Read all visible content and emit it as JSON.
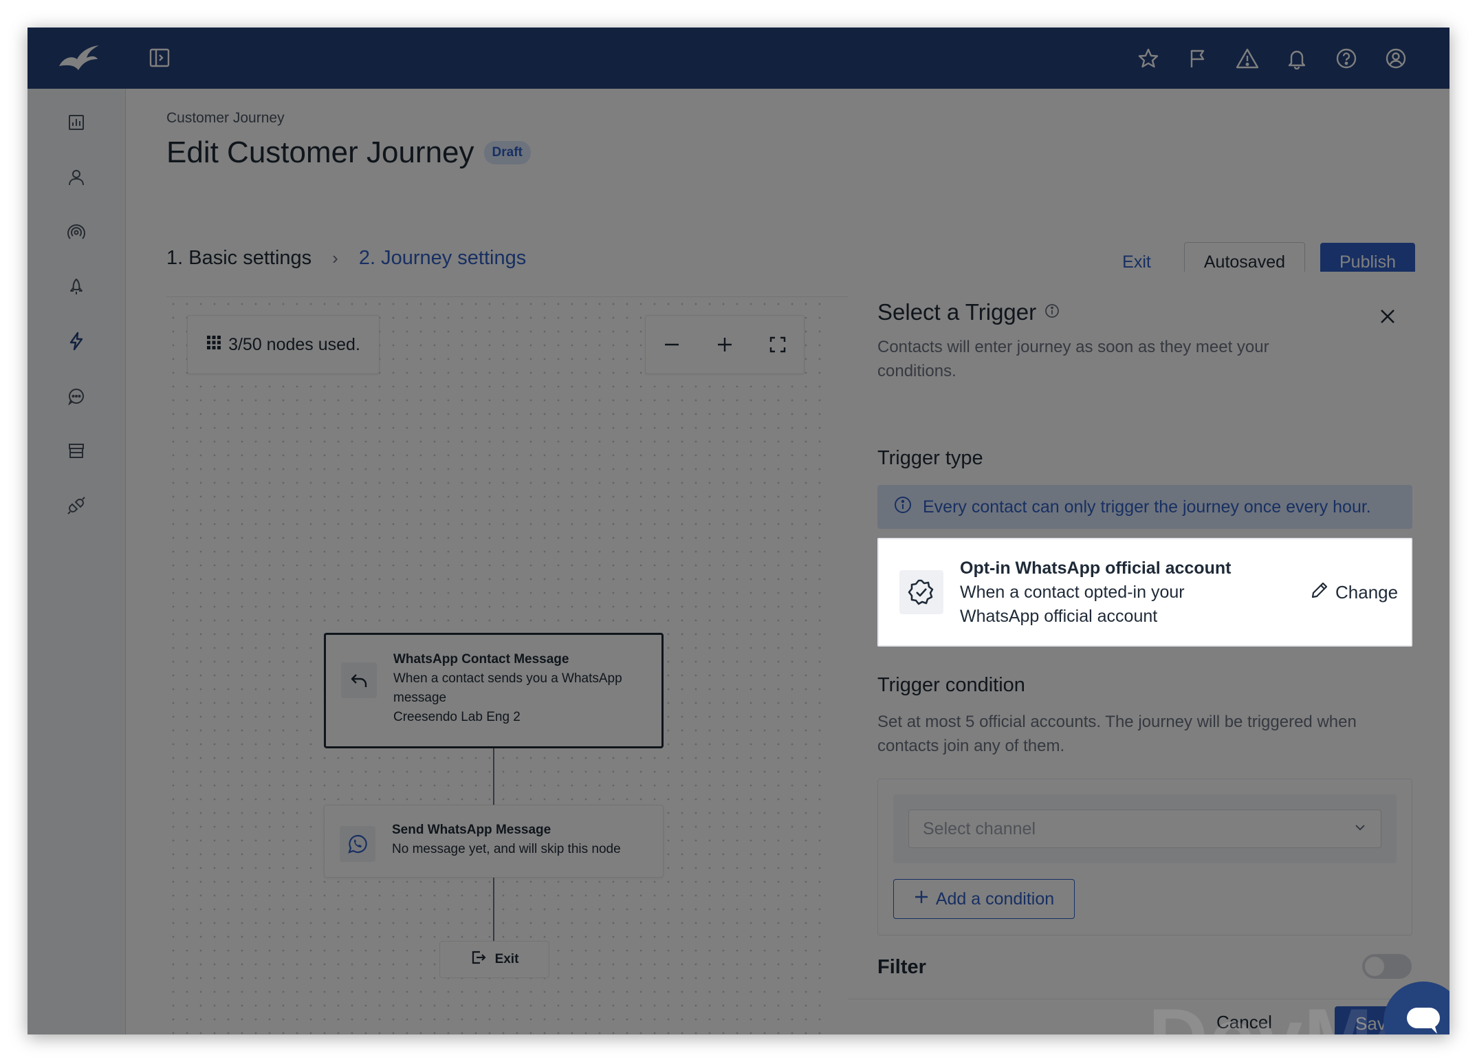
{
  "header": {
    "icons": [
      "logo-icon",
      "panel-toggle-icon",
      "star-icon",
      "flag-icon",
      "warning-icon",
      "bell-icon",
      "help-icon",
      "user-icon"
    ]
  },
  "sidebar": {
    "icons": [
      "chart-icon",
      "contacts-icon",
      "broadcast-icon",
      "rocket-icon",
      "lightning-icon",
      "chat-icon",
      "store-icon",
      "integration-icon"
    ]
  },
  "page": {
    "breadcrumb": "Customer Journey",
    "title": "Edit Customer Journey",
    "status_badge": "Draft"
  },
  "steps": {
    "step1": "1. Basic settings",
    "separator": "›",
    "step2": "2. Journey settings"
  },
  "actions": {
    "exit": "Exit",
    "autosaved": "Autosaved",
    "publish": "Publish"
  },
  "canvas": {
    "nodes_used": "3/50 nodes used.",
    "node1": {
      "title": "WhatsApp Contact Message",
      "line1": "When a contact sends you a WhatsApp",
      "line2": "message",
      "line3": "Creesendo Lab Eng 2"
    },
    "node2": {
      "title": "Send WhatsApp Message",
      "line1": "No message yet, and will skip this node"
    },
    "exit_node": "Exit"
  },
  "panel": {
    "title": "Select a Trigger",
    "subtitle": "Contacts will enter journey as soon as they meet your conditions.",
    "trigger_type_heading": "Trigger type",
    "info_banner": "Every contact can only trigger the journey once every hour.",
    "trigger_card": {
      "title": "Opt-in WhatsApp official account",
      "desc_line1": "When a contact opted-in your",
      "desc_line2": "WhatsApp official account",
      "change": "Change"
    },
    "trigger_condition_heading": "Trigger condition",
    "condition_text": "Set at most 5 official accounts. The journey will be triggered when contacts join any of them.",
    "select_placeholder": "Select channel",
    "add_condition": "Add a condition",
    "filter_label": "Filter",
    "filter_enabled": false,
    "cancel": "Cancel",
    "save": "Save"
  },
  "watermark": "DevMode",
  "colors": {
    "brand_navy": "#24427c",
    "accent_blue": "#2f5fc4",
    "info_bg": "#dbe6fb"
  }
}
